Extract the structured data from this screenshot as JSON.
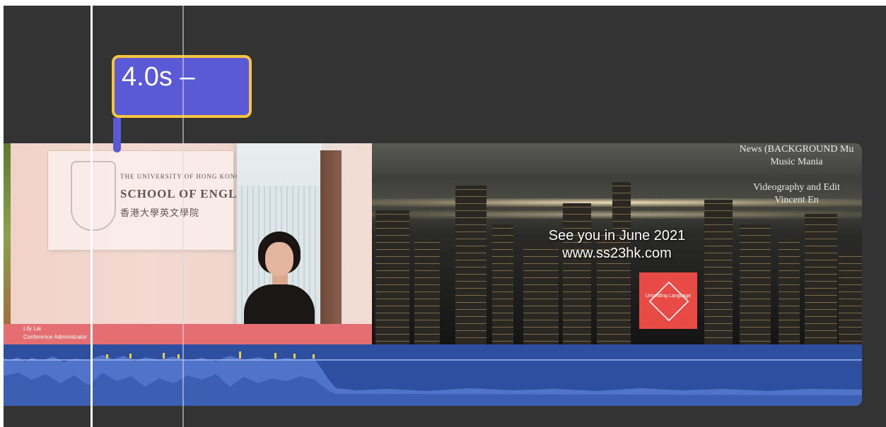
{
  "duration_tag": {
    "label": "4.0s –"
  },
  "clip_office": {
    "plaque_lines": [
      "THE UNIVERSITY OF HONG KONG",
      "SCHOOL OF ENGLISH",
      "香港大學英文學院"
    ],
    "lower_third": {
      "name": "Lily Lai",
      "title": "Conference Administrator"
    }
  },
  "clip_skyline": {
    "credits": [
      "News (BACKGROUND Mu",
      "Music Mania",
      "",
      "Videography and Edit",
      "Vincent En"
    ],
    "tagline_1": "See you in June 2021",
    "tagline_2": "www.ss23hk.com",
    "logo_text": "Unsettling Language"
  },
  "colors": {
    "timeline_bg": "#333333",
    "duration_tag_fill": "#5a59d6",
    "duration_tag_border": "#f6c53b",
    "audio_track": "#2e4f9f",
    "lower_third": "#e46e72",
    "logo": "#e84a45"
  }
}
